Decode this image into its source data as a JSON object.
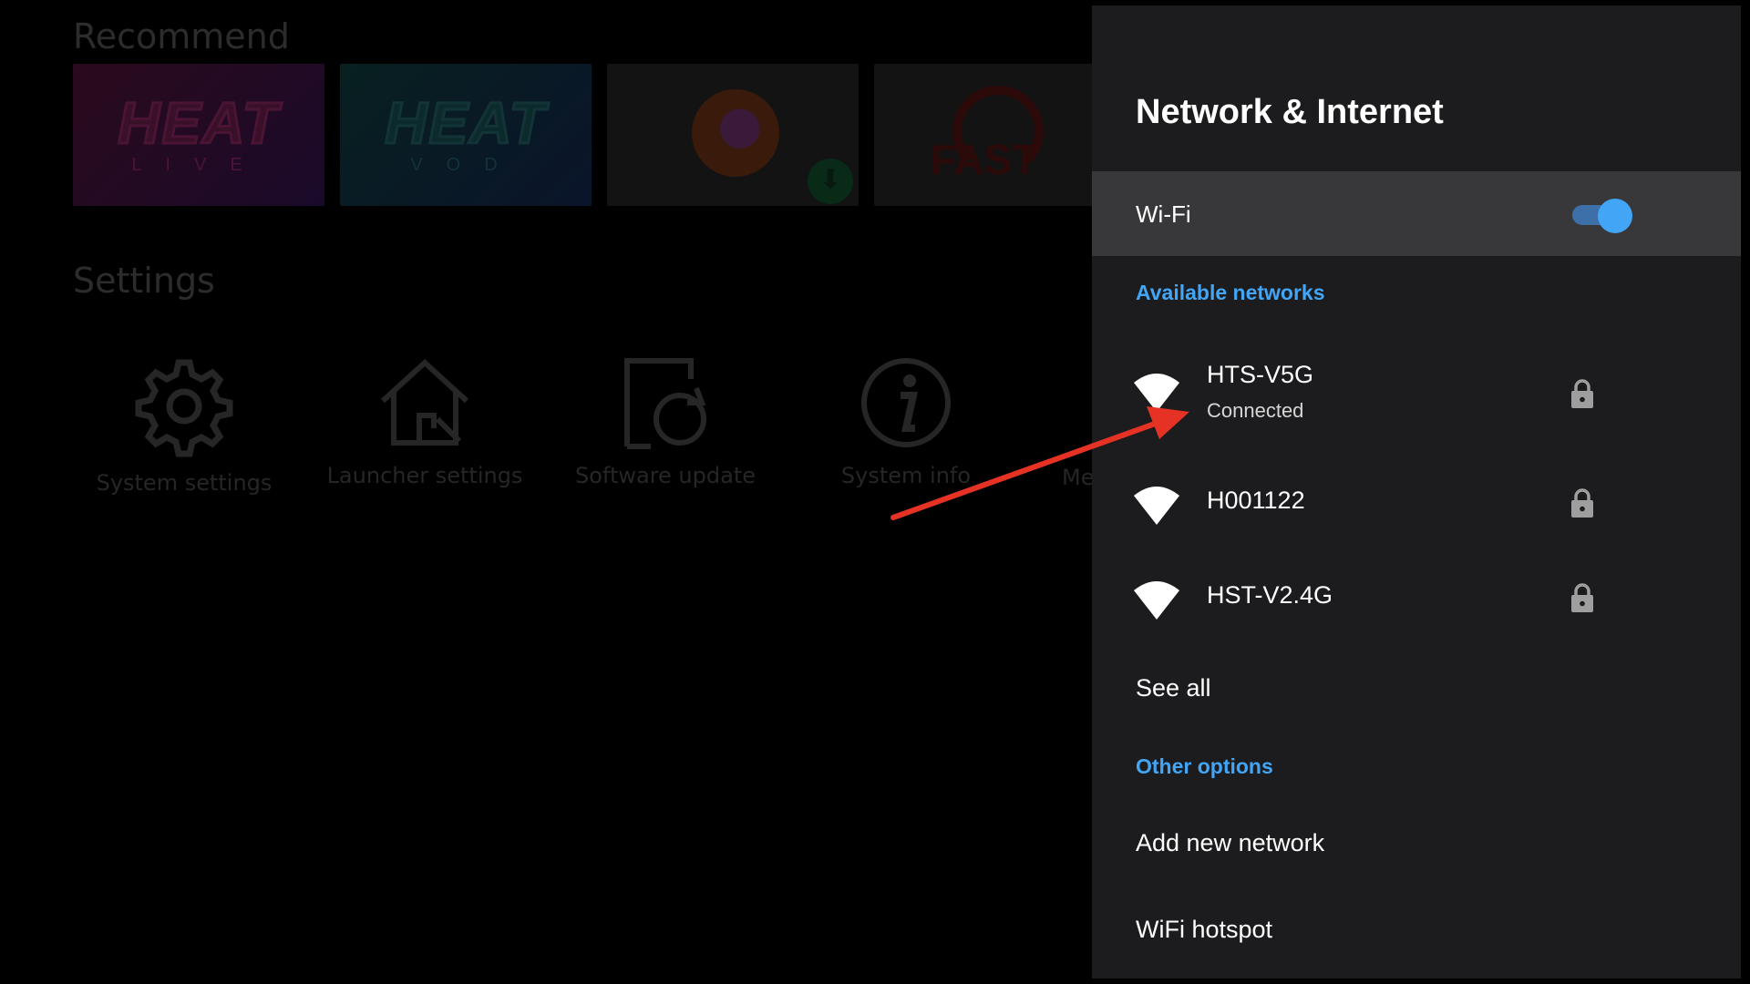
{
  "background": {
    "recommend_title": "Recommend",
    "tiles": [
      {
        "name": "heat-live",
        "word": "HEAT",
        "sub": "LIVE"
      },
      {
        "name": "heat-vod",
        "word": "HEAT",
        "sub": "VOD"
      },
      {
        "name": "firefox",
        "icon": "firefox-icon"
      },
      {
        "name": "fast",
        "word": "FAST"
      }
    ],
    "settings_title": "Settings",
    "settings_items": [
      {
        "label": "System settings",
        "icon": "gear-icon"
      },
      {
        "label": "Launcher settings",
        "icon": "house-wrench-icon"
      },
      {
        "label": "Software update",
        "icon": "update-icon"
      },
      {
        "label": "System info",
        "icon": "info-icon"
      },
      {
        "label": "Me"
      }
    ]
  },
  "panel": {
    "title": "Network & Internet",
    "wifi": {
      "label": "Wi-Fi",
      "enabled": true
    },
    "available_label": "Available networks",
    "networks": [
      {
        "name": "HTS-V5G",
        "status": "Connected",
        "secured": true
      },
      {
        "name": "H001122",
        "status": "",
        "secured": true
      },
      {
        "name": "HST-V2.4G",
        "status": "",
        "secured": true
      }
    ],
    "see_all": "See all",
    "other_label": "Other options",
    "add_network": "Add new network",
    "wifi_hotspot": "WiFi hotspot"
  },
  "colors": {
    "panel_bg": "#1c1c1e",
    "highlight_row": "#38383a",
    "accent": "#42a5f5",
    "annotation_arrow": "#e53224"
  }
}
